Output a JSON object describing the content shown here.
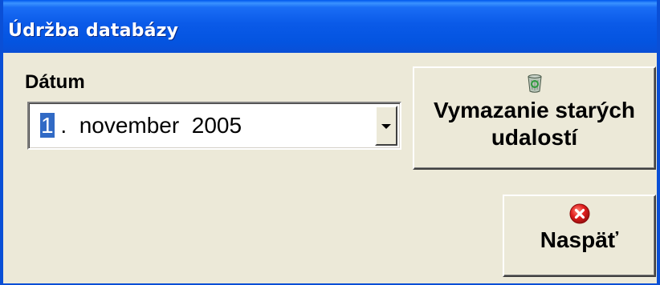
{
  "window": {
    "title": "Údržba databázy"
  },
  "form": {
    "date_label": "Dátum",
    "date_value": {
      "day": "1",
      "rest": " .  november  2005"
    }
  },
  "buttons": {
    "delete_old_events": {
      "label": "Vymazanie starých\nudalostí",
      "icon": "recycle-bin-icon"
    },
    "back": {
      "label": "Naspäť",
      "icon": "error-close-icon"
    }
  },
  "colors": {
    "titlebar": "#0a5ae8",
    "window_face": "#ece9d8",
    "selection": "#316ac5",
    "error_icon": "#e11d1d"
  }
}
